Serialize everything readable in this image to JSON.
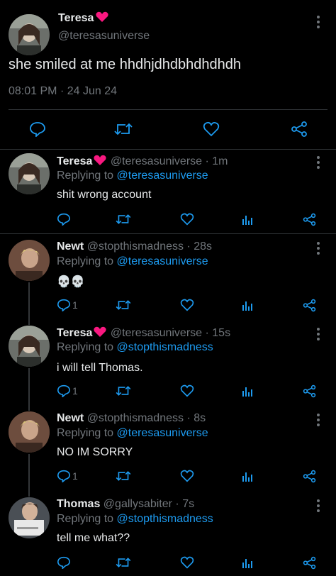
{
  "main_tweet": {
    "display_name": "Teresa",
    "handle": "@teresasuniverse",
    "text": "she smiled at me hhdhjdhdbhdhdhdh",
    "time": "08:01 PM",
    "date_separator": "·",
    "date": "24 Jun 24"
  },
  "replies": [
    {
      "display_name": "Teresa",
      "handle": "@teresasuniverse",
      "time": "· 1m",
      "replying_prefix": "Replying to ",
      "replying_to": "@teresasuniverse",
      "text": "shit wrong account",
      "reply_count": ""
    },
    {
      "display_name": "Newt",
      "handle": "@stopthismadness",
      "time": "· 28s",
      "replying_prefix": "Replying to ",
      "replying_to": "@teresasuniverse",
      "text": "💀💀",
      "reply_count": "1"
    },
    {
      "display_name": "Teresa",
      "handle": "@teresasuniverse",
      "time": "· 15s",
      "replying_prefix": "Replying to ",
      "replying_to": "@stopthismadness",
      "text": "i will tell Thomas.",
      "reply_count": "1"
    },
    {
      "display_name": "Newt",
      "handle": "@stopthismadness",
      "time": "· 8s",
      "replying_prefix": "Replying to ",
      "replying_to": "@teresasuniverse",
      "text": "NO IM SORRY",
      "reply_count": "1"
    },
    {
      "display_name": "Thomas",
      "handle": "@gallysabiter",
      "time": "· 7s",
      "replying_prefix": "Replying to ",
      "replying_to": "@stopthismadness",
      "text": "tell me what??",
      "reply_count": ""
    }
  ],
  "colors": {
    "accent": "#1d9bf0",
    "heart_emoji": "#f91880",
    "muted": "#71767b",
    "divider": "#2f3336"
  },
  "icons": [
    "more-vertical-icon",
    "reply-icon",
    "retweet-icon",
    "like-icon",
    "share-icon",
    "analytics-icon",
    "heart-emoji-icon",
    "skull-emoji-icon"
  ]
}
